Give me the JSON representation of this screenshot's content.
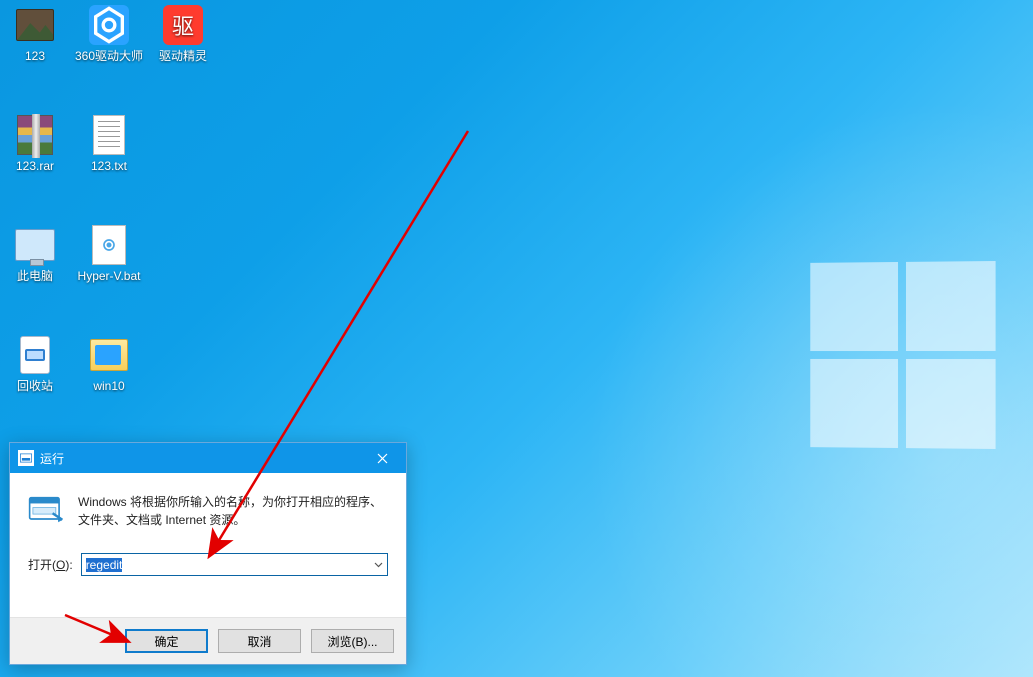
{
  "desktop": {
    "icons": [
      {
        "id": "folder-123",
        "label": "123",
        "type": "folder-photo"
      },
      {
        "id": "driver-360",
        "label": "360驱动大师",
        "type": "hex-blue"
      },
      {
        "id": "driver-jl",
        "label": "驱动精灵",
        "type": "hex-red",
        "glyph": "驱"
      },
      {
        "id": "rar-123",
        "label": "123.rar",
        "type": "rar"
      },
      {
        "id": "txt-123",
        "label": "123.txt",
        "type": "txt"
      },
      {
        "id": "this-pc",
        "label": "此电脑",
        "type": "pc"
      },
      {
        "id": "hyperv-bat",
        "label": "Hyper-V.bat",
        "type": "bat"
      },
      {
        "id": "recycle",
        "label": "回收站",
        "type": "bin"
      },
      {
        "id": "win10",
        "label": "win10",
        "type": "win10"
      }
    ]
  },
  "run_dialog": {
    "title": "运行",
    "description": "Windows 将根据你所输入的名称，为你打开相应的程序、文件夹、文档或 Internet 资源。",
    "open_label_prefix": "打开(",
    "open_label_key": "O",
    "open_label_suffix": "):",
    "input_value": "regedit",
    "buttons": {
      "ok": "确定",
      "cancel": "取消",
      "browse": "浏览(B)..."
    }
  }
}
